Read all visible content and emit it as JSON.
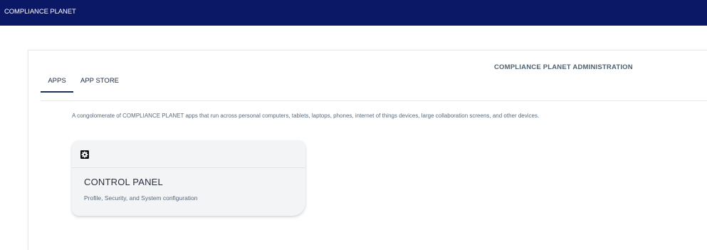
{
  "header": {
    "brand": "COMPLIANCE PLANET"
  },
  "main": {
    "admin_title": "COMPLIANCE PLANET ADMINISTRATION",
    "tabs": [
      {
        "label": "APPS",
        "active": true
      },
      {
        "label": "APP STORE",
        "active": false
      }
    ],
    "description": "A congolomerate of COMPLIANCE PLANET apps that run across personal computers, tablets, laptops, phones, internet of things devices, large collaboration screens, and other devices.",
    "apps": [
      {
        "icon": "settings-icon",
        "title": "CONTROL PANEL",
        "subtitle": "Profile, Security, and System configuration"
      }
    ]
  },
  "colors": {
    "header_bg": "#0b1866",
    "accent": "#1f2f55"
  }
}
